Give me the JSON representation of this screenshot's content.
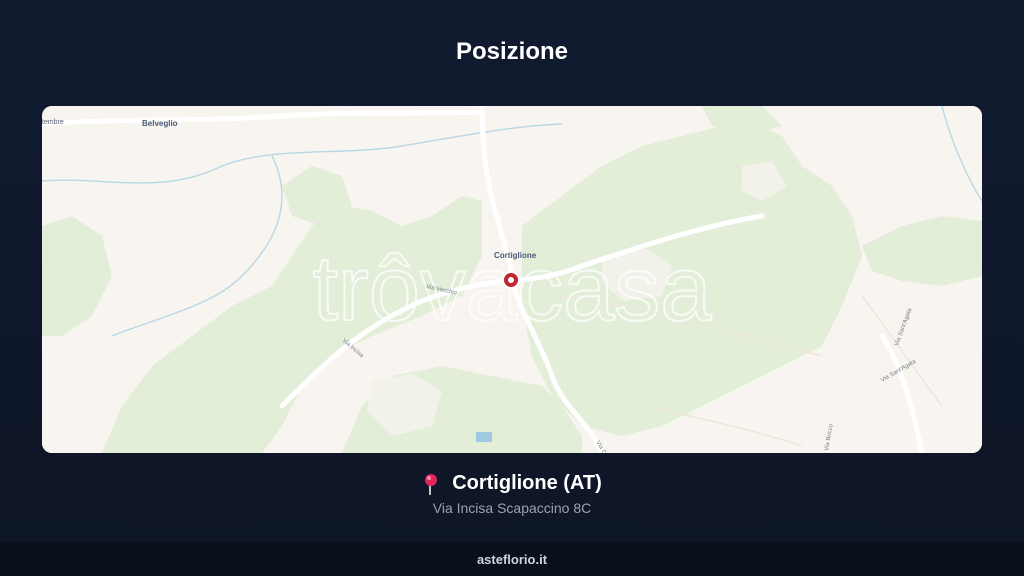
{
  "header": {
    "title": "Posizione"
  },
  "map": {
    "watermark": "trôvacasa",
    "labels": {
      "town_belveglio": "Belveglio",
      "town_cortiglione": "Cortiglione",
      "edge_settembre": "tembre",
      "road_vecchio": "Via Vecchio",
      "road_incisa": "Via Incisa",
      "road_santagata_1": "Via Sant'Agata",
      "road_santagata_2": "Via Sant'Agata",
      "road_bottom": "Via C",
      "road_bottom_right": "Via Bricco"
    },
    "colors": {
      "land": "#f8f4ef",
      "forest": "#e3eed8",
      "water": "#9ec9e0",
      "marker": "#c0262d",
      "road": "#ffffff"
    }
  },
  "location": {
    "icon": "pin-icon",
    "name": "Cortiglione (AT)",
    "address": "Via Incisa Scapaccino 8C"
  },
  "footer": {
    "site": "asteflorio.it"
  }
}
